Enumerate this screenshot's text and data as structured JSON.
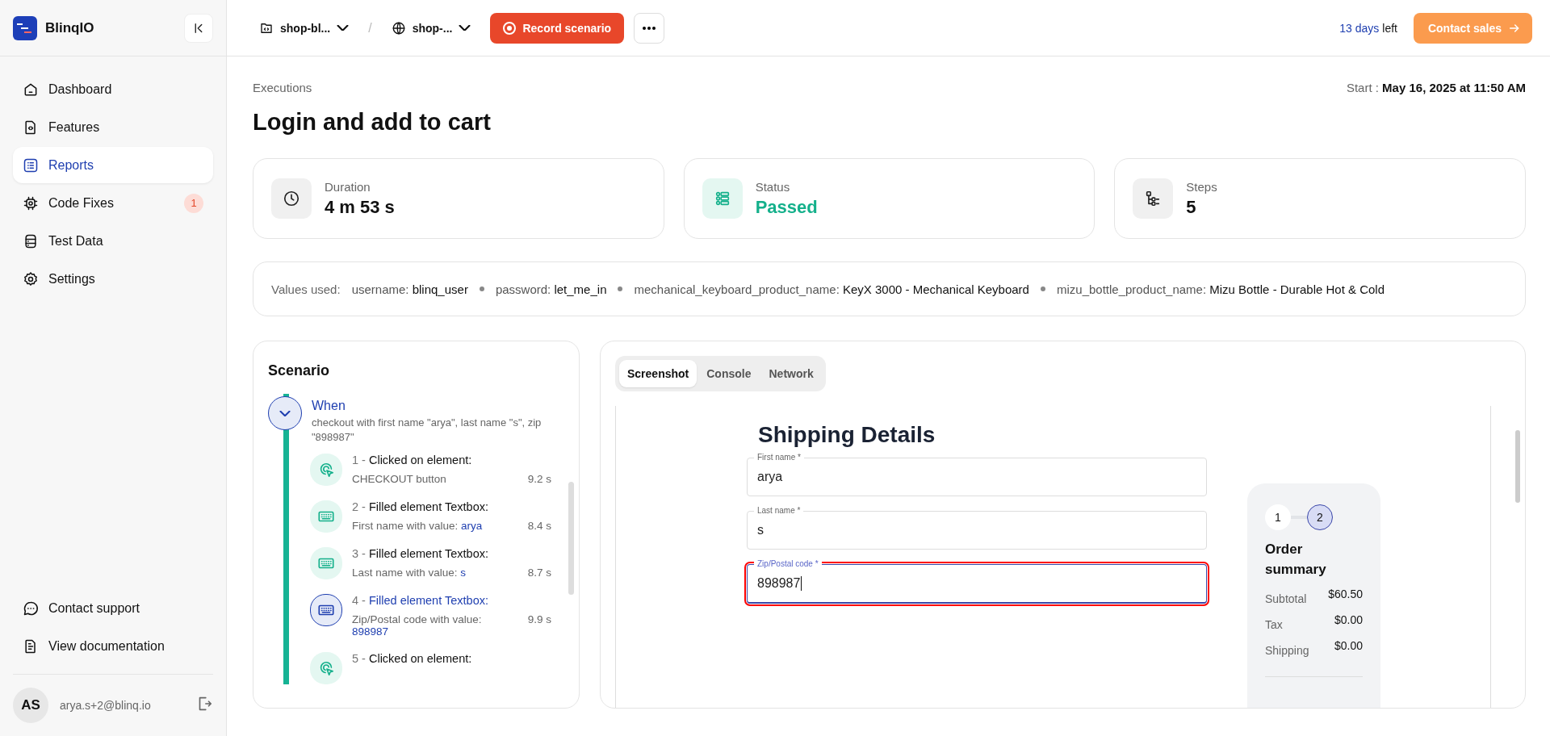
{
  "brand": {
    "name": "BlinqIO"
  },
  "sidebar": {
    "items": [
      {
        "label": "Dashboard",
        "kind": "home",
        "selected": false
      },
      {
        "label": "Features",
        "kind": "file-code",
        "selected": false
      },
      {
        "label": "Reports",
        "kind": "list",
        "selected": true
      },
      {
        "label": "Code Fixes",
        "kind": "chip",
        "selected": false,
        "badge": "1"
      },
      {
        "label": "Test Data",
        "kind": "database",
        "selected": false
      },
      {
        "label": "Settings",
        "kind": "gear",
        "selected": false
      }
    ],
    "footer_items": [
      {
        "label": "Contact support",
        "kind": "chat"
      },
      {
        "label": "View documentation",
        "kind": "doc"
      }
    ],
    "user": {
      "initials": "AS",
      "email": "arya.s+2@blinq.io"
    }
  },
  "topbar": {
    "separator": "/",
    "project": "shop-bl...",
    "environment": "shop-...",
    "record_button": "Record scenario",
    "trial_count": "13 days",
    "trial_suffix": "left",
    "contact_button": "Contact sales"
  },
  "header": {
    "breadcrumb": "Executions",
    "title": "Login and add to cart",
    "start_label": "Start :",
    "start_value": "May 16, 2025 at 11:50 AM"
  },
  "stats": [
    {
      "label": "Duration",
      "value": "4 m 53 s",
      "kind": "clock"
    },
    {
      "label": "Status",
      "value": "Passed",
      "kind": "status"
    },
    {
      "label": "Steps",
      "value": "5",
      "kind": "steps"
    }
  ],
  "values_used": {
    "label": "Values used:",
    "entries": [
      {
        "key": "username:",
        "value": "blinq_user"
      },
      {
        "key": "password:",
        "value": "let_me_in"
      },
      {
        "key": "mechanical_keyboard_product_name:",
        "value": "KeyX 3000 - Mechanical Keyboard"
      },
      {
        "key": "mizu_bottle_product_name:",
        "value": "Mizu Bottle - Durable Hot & Cold"
      }
    ]
  },
  "scenario": {
    "title": "Scenario",
    "group": {
      "keyword": "When",
      "text": "checkout with first name \"arya\", last name \"s\", zip \"898987\"",
      "expanded": true
    },
    "steps": [
      {
        "number": "1 -",
        "action": "Clicked on element:",
        "detail": "CHECKOUT button",
        "time": "9.2 s",
        "kind": "click",
        "selected": false
      },
      {
        "number": "2 -",
        "action": "Filled element Textbox:",
        "detail": "First name with value:",
        "value": "arya",
        "time": "8.4 s",
        "kind": "type",
        "selected": false
      },
      {
        "number": "3 -",
        "action": "Filled element Textbox:",
        "detail": "Last name with value:",
        "value": "s",
        "time": "8.7 s",
        "kind": "type",
        "selected": false
      },
      {
        "number": "4 -",
        "action": "Filled element Textbox:",
        "detail": "Zip/Postal code with value:",
        "value": "898987",
        "time": "9.9 s",
        "kind": "type",
        "selected": true
      },
      {
        "number": "5 -",
        "action": "Clicked on element:",
        "kind": "click",
        "selected": false
      }
    ]
  },
  "viewer": {
    "tabs": [
      {
        "label": "Screenshot",
        "selected": true
      },
      {
        "label": "Console",
        "selected": false
      },
      {
        "label": "Network",
        "selected": false
      }
    ],
    "page": {
      "heading": "Shipping Details",
      "fields": [
        {
          "label": "First name *",
          "value": "arya",
          "focused": false,
          "highlighted": false
        },
        {
          "label": "Last name *",
          "value": "s",
          "focused": false,
          "highlighted": false
        },
        {
          "label": "Zip/Postal code *",
          "value": "898987",
          "focused": true,
          "highlighted": true
        }
      ],
      "summary": {
        "steps": [
          {
            "label": "1",
            "selected": false
          },
          {
            "label": "2",
            "selected": true
          }
        ],
        "title": "Order summary",
        "rows": [
          {
            "label": "Subtotal",
            "value": "$60.50"
          },
          {
            "label": "Tax",
            "value": "$0.00"
          },
          {
            "label": "Shipping",
            "value": "$0.00"
          }
        ]
      }
    }
  }
}
